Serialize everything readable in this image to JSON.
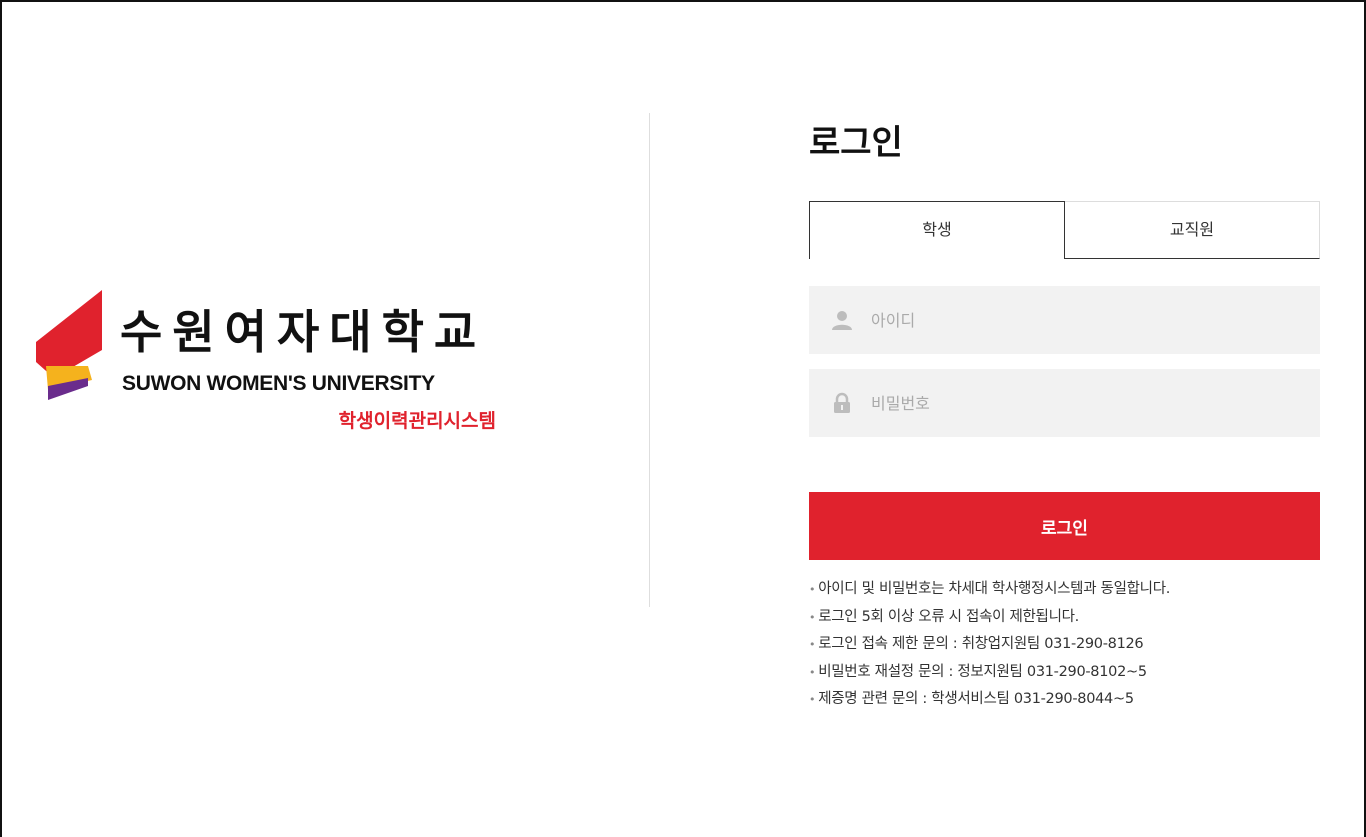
{
  "brand": {
    "name_kr": "수원여자대학교",
    "name_en": "SUWON WOMEN'S UNIVERSITY",
    "system_name": "학생이력관리시스템",
    "colors": {
      "red": "#e0222d",
      "yellow": "#f5b21d",
      "purple": "#6a2c8c"
    }
  },
  "login": {
    "title": "로그인",
    "tabs": [
      {
        "label": "학생",
        "active": true
      },
      {
        "label": "교직원",
        "active": false
      }
    ],
    "id_field": {
      "placeholder": "아이디",
      "value": "",
      "icon": "user-icon"
    },
    "pw_field": {
      "placeholder": "비밀번호",
      "value": "",
      "icon": "lock-icon"
    },
    "submit_label": "로그인",
    "notes": [
      "아이디 및 비밀번호는 차세대 학사행정시스템과 동일합니다.",
      "로그인 5회 이상 오류 시 접속이 제한됩니다.",
      "로그인 접속 제한 문의 : 취창업지원팀 031-290-8126",
      "비밀번호 재설정 문의 : 정보지원팀 031-290-8102~5",
      "제증명 관련 문의 : 학생서비스팀 031-290-8044~5"
    ],
    "accent_color": "#e0222d"
  }
}
